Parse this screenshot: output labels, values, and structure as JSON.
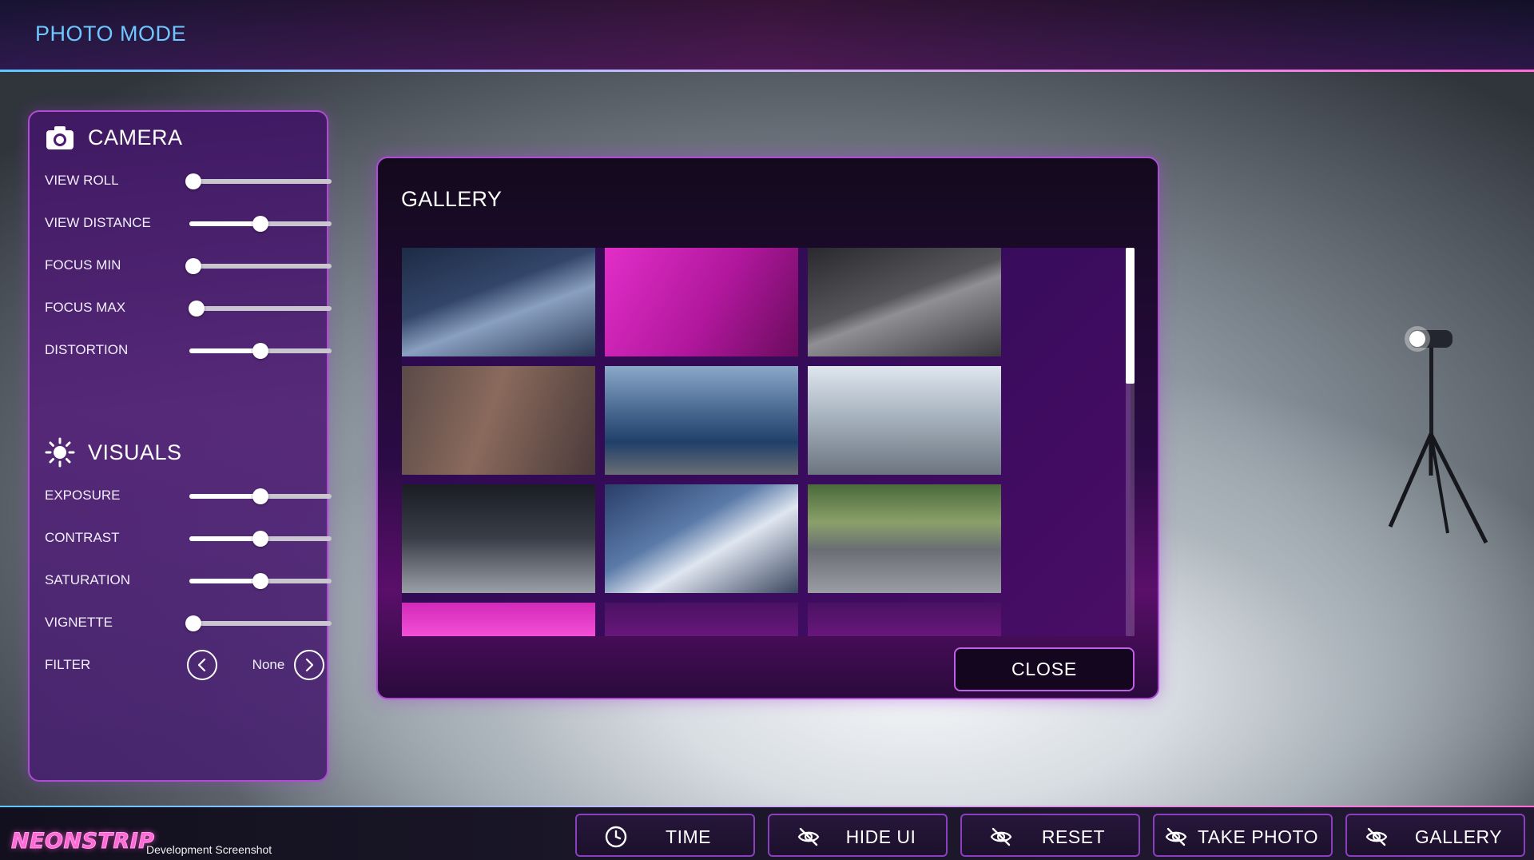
{
  "header": {
    "title": "PHOTO MODE"
  },
  "camera": {
    "title": "CAMERA",
    "icon": "camera-icon",
    "sliders": [
      {
        "label": "VIEW ROLL",
        "value": 0.03
      },
      {
        "label": "VIEW DISTANCE",
        "value": 0.5
      },
      {
        "label": "FOCUS MIN",
        "value": 0.03
      },
      {
        "label": "FOCUS MAX",
        "value": 0.05
      },
      {
        "label": "DISTORTION",
        "value": 0.5
      }
    ]
  },
  "visuals": {
    "title": "VISUALS",
    "icon": "sun-icon",
    "sliders": [
      {
        "label": "EXPOSURE",
        "value": 0.5
      },
      {
        "label": "CONTRAST",
        "value": 0.5
      },
      {
        "label": "SATURATION",
        "value": 0.5
      },
      {
        "label": "VIGNETTE",
        "value": 0.03
      }
    ],
    "filter": {
      "label": "FILTER",
      "value": "None"
    }
  },
  "gallery": {
    "title": "GALLERY",
    "close_label": "CLOSE",
    "scroll_fraction": 0.35,
    "thumbnails": [
      {
        "name": "thumb-street-low-angle",
        "bg": "linear-gradient(160deg,#1d2b44 0%,#33466a 40%,#8aa0c0 60%,#2a3a58 100%)"
      },
      {
        "name": "thumb-magenta-figure",
        "bg": "linear-gradient(120deg,#e22ec8 0%,#b0179c 55%,#6a0c5e 100%)"
      },
      {
        "name": "thumb-hallway",
        "bg": "linear-gradient(160deg,#2a2a2e 0%,#55555a 45%,#8f8f94 55%,#3a3a3e 100%)"
      },
      {
        "name": "thumb-portrait",
        "bg": "linear-gradient(110deg,#5a4a48 0%,#8a6a5c 45%,#4a3a3a 100%)"
      },
      {
        "name": "thumb-blue-skirt",
        "bg": "linear-gradient(180deg,#8aa8c8 0%,#4a6a92 40%,#20406a 70%,#6a6e74 100%)"
      },
      {
        "name": "thumb-walking-street",
        "bg": "linear-gradient(180deg,#dfe6ee 0%,#a8b4c0 45%,#6c7580 100%)"
      },
      {
        "name": "thumb-showroom",
        "bg": "linear-gradient(180deg,#1a1d24 0%,#3a3e48 50%,#9aa0a8 100%)"
      },
      {
        "name": "thumb-sports-car",
        "bg": "linear-gradient(150deg,#2a3e6a 0%,#5a7aa8 40%,#dfe6f0 60%,#3a4660 100%)"
      },
      {
        "name": "thumb-motorcycle",
        "bg": "linear-gradient(180deg,#4a6a3a 0%,#8aa06a 35%,#6a6e74 60%,#9a9ea4 100%)"
      },
      {
        "name": "thumb-neon-stage-1",
        "bg": "linear-gradient(180deg,#d02ab8 0%,#ff5ae0 40%,#6a0c5e 100%)"
      },
      {
        "name": "thumb-neon-stage-2",
        "bg": "linear-gradient(180deg,#4a1262 0%,#7a1a8a 50%,#2a0a3c 100%)"
      },
      {
        "name": "thumb-neon-stage-3",
        "bg": "linear-gradient(180deg,#4a1262 0%,#7a1a8a 50%,#2a0a3c 100%)"
      }
    ]
  },
  "footer": {
    "logo": "NEONSTRIP",
    "note": "Development Screenshot",
    "buttons": [
      {
        "label": "TIME",
        "icon": "clock-icon"
      },
      {
        "label": "HIDE UI",
        "icon": "eye-slash-icon"
      },
      {
        "label": "RESET",
        "icon": "eye-slash-icon"
      },
      {
        "label": "TAKE PHOTO",
        "icon": "eye-slash-icon"
      },
      {
        "label": "GALLERY",
        "icon": "eye-slash-icon"
      }
    ]
  },
  "colors": {
    "accent_border": "#b04bd4",
    "header_text": "#6ec8ff",
    "logo_pink": "#ff6ad5"
  }
}
